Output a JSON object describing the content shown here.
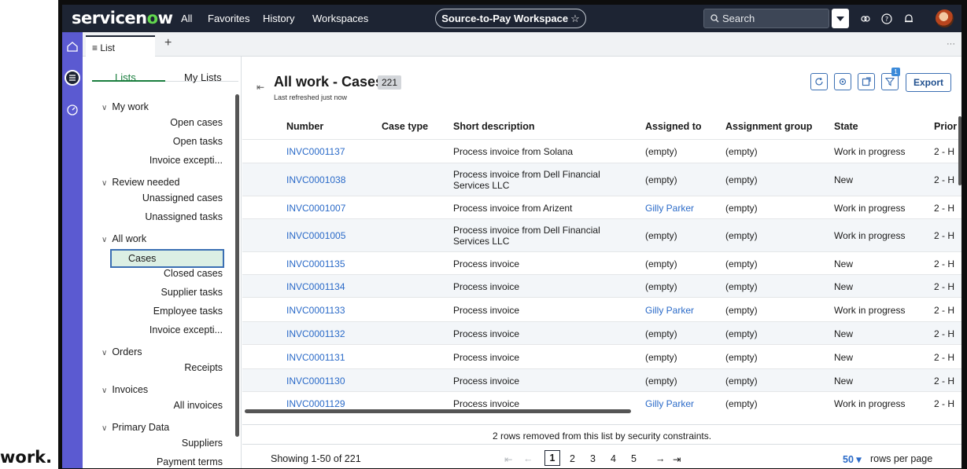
{
  "caption": "work.",
  "topnav": {
    "logo_prefix": "servicen",
    "logo_o": "o",
    "logo_suffix": "w",
    "items": [
      "All",
      "Favorites",
      "History",
      "Workspaces"
    ],
    "workspace": "Source-to-Pay Workspace",
    "workspace_star": "☆",
    "search_placeholder": "Search"
  },
  "tabs": {
    "active_label": "≡ List",
    "add": "+",
    "more": "···"
  },
  "sidebar": {
    "tabs": [
      "Lists",
      "My Lists"
    ],
    "groups": [
      {
        "label": "My work",
        "items": [
          "Open cases",
          "Open tasks",
          "Invoice excepti..."
        ]
      },
      {
        "label": "Review needed",
        "items": [
          "Unassigned cases",
          "Unassigned tasks"
        ]
      },
      {
        "label": "All work",
        "items": [
          "Cases",
          "Closed cases",
          "Supplier tasks",
          "Employee tasks",
          "Invoice excepti..."
        ]
      },
      {
        "label": "Orders",
        "items": [
          "Receipts"
        ]
      },
      {
        "label": "Invoices",
        "items": [
          "All invoices"
        ]
      },
      {
        "label": "Primary Data",
        "items": [
          "Suppliers",
          "Payment terms"
        ]
      }
    ],
    "selected": "Cases"
  },
  "list": {
    "title": "All work - Cases",
    "count": "221",
    "refreshed": "Last refreshed just now",
    "export_label": "Export",
    "filter_count": "1",
    "columns": [
      "Number",
      "Case type",
      "Short description",
      "Assigned to",
      "Assignment group",
      "State",
      "Prior"
    ],
    "rows": [
      {
        "number": "INVC0001137",
        "case_type": "",
        "desc": "Process invoice from Solana",
        "assigned": "(empty)",
        "group": "(empty)",
        "state": "Work in progress",
        "priority": "2 - H"
      },
      {
        "number": "INVC0001038",
        "case_type": "",
        "desc": "Process invoice from Dell Financial Services LLC",
        "assigned": "(empty)",
        "group": "(empty)",
        "state": "New",
        "priority": "2 - H"
      },
      {
        "number": "INVC0001007",
        "case_type": "",
        "desc": "Process invoice from Arizent",
        "assigned": "Gilly Parker",
        "group": "(empty)",
        "state": "Work in progress",
        "priority": "2 - H"
      },
      {
        "number": "INVC0001005",
        "case_type": "",
        "desc": "Process invoice from Dell Financial Services LLC",
        "assigned": "(empty)",
        "group": "(empty)",
        "state": "Work in progress",
        "priority": "2 - H"
      },
      {
        "number": "INVC0001135",
        "case_type": "",
        "desc": "Process invoice",
        "assigned": "(empty)",
        "group": "(empty)",
        "state": "New",
        "priority": "2 - H"
      },
      {
        "number": "INVC0001134",
        "case_type": "",
        "desc": "Process invoice",
        "assigned": "(empty)",
        "group": "(empty)",
        "state": "New",
        "priority": "2 - H"
      },
      {
        "number": "INVC0001133",
        "case_type": "",
        "desc": "Process invoice",
        "assigned": "Gilly Parker",
        "group": "(empty)",
        "state": "Work in progress",
        "priority": "2 - H"
      },
      {
        "number": "INVC0001132",
        "case_type": "",
        "desc": "Process invoice",
        "assigned": "(empty)",
        "group": "(empty)",
        "state": "New",
        "priority": "2 - H"
      },
      {
        "number": "INVC0001131",
        "case_type": "",
        "desc": "Process invoice",
        "assigned": "(empty)",
        "group": "(empty)",
        "state": "New",
        "priority": "2 - H"
      },
      {
        "number": "INVC0001130",
        "case_type": "",
        "desc": "Process invoice",
        "assigned": "(empty)",
        "group": "(empty)",
        "state": "New",
        "priority": "2 - H"
      },
      {
        "number": "INVC0001129",
        "case_type": "",
        "desc": "Process invoice",
        "assigned": "Gilly Parker",
        "group": "(empty)",
        "state": "Work in progress",
        "priority": "2 - H"
      }
    ],
    "security_note": "2 rows removed from this list by security constraints.",
    "showing": "Showing 1-50 of 221",
    "pager": {
      "first": "⇤",
      "prev": "←",
      "pages": [
        "1",
        "2",
        "3",
        "4",
        "5"
      ],
      "next": "→",
      "last": "⇥",
      "current": "1"
    },
    "rows_per_page_value": "50 ▾",
    "rows_per_page_label": "rows per page"
  },
  "colors": {
    "nav_bg": "#1d2433",
    "rail": "#5b5ad1",
    "accent_green": "#1a7e3e",
    "link": "#2a6ac8",
    "selected_bg": "#dcefe4"
  }
}
